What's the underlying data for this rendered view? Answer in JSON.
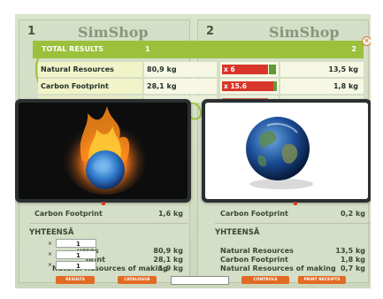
{
  "shops": [
    {
      "number": "1",
      "name": "SimShop"
    },
    {
      "number": "2",
      "name": "SimShop"
    }
  ],
  "results": {
    "title": "TOTAL RESULTS",
    "col1": "1",
    "col2": "2",
    "rows": [
      {
        "label": "Natural Resources",
        "value1": "80,9 kg",
        "ratio": "x 6",
        "value2": "13,5 kg"
      },
      {
        "label": "Carbon Footprint",
        "value1": "28,1 kg",
        "ratio": "x 15.6",
        "value2": "1,8 kg"
      },
      {
        "label": "Natural Resources of making",
        "value1": "1,9 kg",
        "ratio": "",
        "value2": "0,7 kg"
      }
    ],
    "close_icon": "close-icon"
  },
  "images": {
    "left": "burning-earth-image",
    "right": "earth-globe-image"
  },
  "summary_left": {
    "carbon_label": "Carbon Footprint",
    "carbon_value": "1,6 kg",
    "heading": "YHTEENSÄ",
    "natural_label": "urces",
    "natural_value": "80,9 kg",
    "carbon2_label": "print",
    "carbon2_value": "28,1 kg",
    "making_label": "Natural Resources of making",
    "making_value": "1,9 kg",
    "quantities": [
      "1",
      "1",
      "1"
    ]
  },
  "summary_right": {
    "carbon_label": "Carbon Footprint",
    "carbon_value": "0,2 kg",
    "heading": "YHTEENSÄ",
    "natural_label": "Natural Resources",
    "natural_value": "13,5 kg",
    "carbon2_label": "Carbon Footprint",
    "carbon2_value": "1,8 kg",
    "making_label": "Natural Resources of making",
    "making_value": "0,7 kg"
  },
  "buttons": {
    "results": "RESULTS",
    "catalogue": "CATALOGUE",
    "controls": "CONTROLS",
    "print_receipts": "PRINT RECEIPTS"
  },
  "colors": {
    "header_green": "#9bc13c",
    "bar_red": "#d8362a",
    "bar_green": "#5e9b34",
    "button_orange": "#e26a22"
  }
}
